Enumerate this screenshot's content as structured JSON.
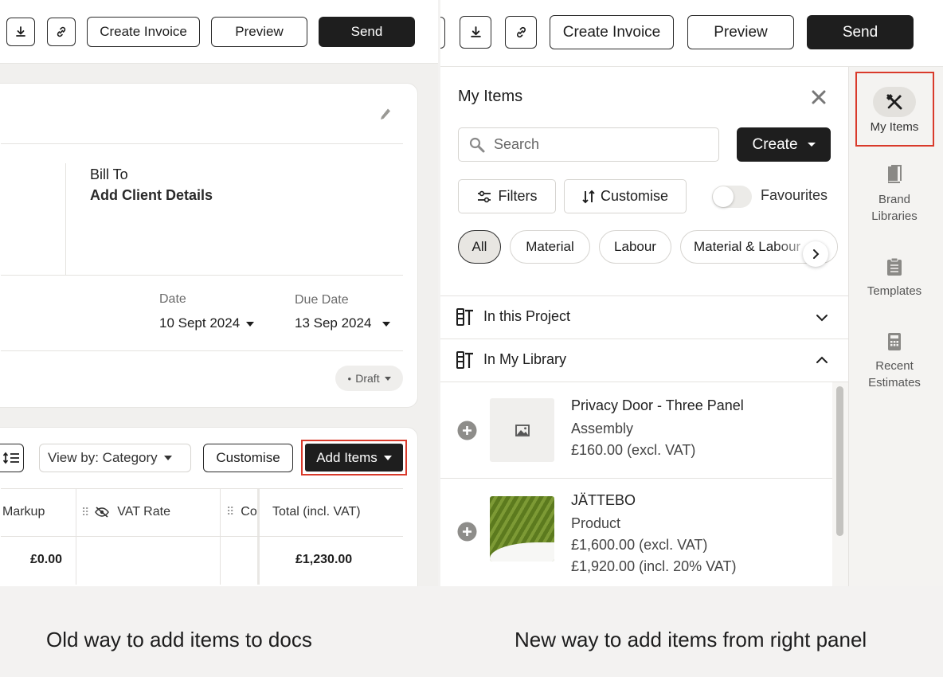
{
  "left": {
    "toolbar": {
      "create_invoice": "Create Invoice",
      "preview": "Preview",
      "send": "Send"
    },
    "bill_to": {
      "heading": "Bill To",
      "value": "Add Client Details"
    },
    "date": {
      "label": "Date",
      "value": "10 Sept 2024"
    },
    "due_date": {
      "label": "Due Date",
      "value": "13 Sep 2024"
    },
    "status": "Draft",
    "items_toolbar": {
      "view_by": "View by: Category",
      "customise": "Customise",
      "add_items": "Add Items"
    },
    "table": {
      "columns": [
        "Markup",
        "VAT Rate",
        "Co",
        "Total (incl. VAT)"
      ],
      "row": {
        "markup": "£0.00",
        "vat_rate": "",
        "total": "£1,230.00"
      }
    }
  },
  "right": {
    "toolbar": {
      "create_invoice": "Create Invoice",
      "preview": "Preview",
      "send": "Send"
    },
    "panel": {
      "title": "My Items",
      "search_placeholder": "Search",
      "create": "Create",
      "filters": "Filters",
      "customise": "Customise",
      "favourites": "Favourites",
      "favourites_on": false,
      "chips": [
        "All",
        "Material",
        "Labour",
        "Material & Labour"
      ],
      "sections": [
        {
          "label": "In this Project",
          "expanded": false
        },
        {
          "label": "In My Library",
          "expanded": true
        }
      ],
      "items": [
        {
          "name": "Privacy Door - Three Panel",
          "type": "Assembly",
          "price": "£160.00 (excl. VAT)",
          "price_incl": "",
          "thumb": "image-placeholder"
        },
        {
          "name": "JÄTTEBO",
          "type": "Product",
          "price": "£1,600.00 (excl. VAT)",
          "price_incl": "£1,920.00 (incl. 20% VAT)",
          "thumb": "green-fabric"
        }
      ]
    },
    "rail": [
      {
        "label": "My Items",
        "icon": "tools-icon",
        "active": true
      },
      {
        "label": "Brand Libraries",
        "icon": "book-icon",
        "active": false
      },
      {
        "label": "Templates",
        "icon": "clipboard-icon",
        "active": false
      },
      {
        "label": "Recent Estimates",
        "icon": "calculator-icon",
        "active": false
      }
    ]
  },
  "captions": {
    "left": "Old way to add items to docs",
    "right": "New way to add items from right panel"
  },
  "colors": {
    "highlight": "#d93a2b",
    "dark": "#1e1e1e",
    "background": "#f3f2f1",
    "chip_active": "#e8e6e2"
  }
}
